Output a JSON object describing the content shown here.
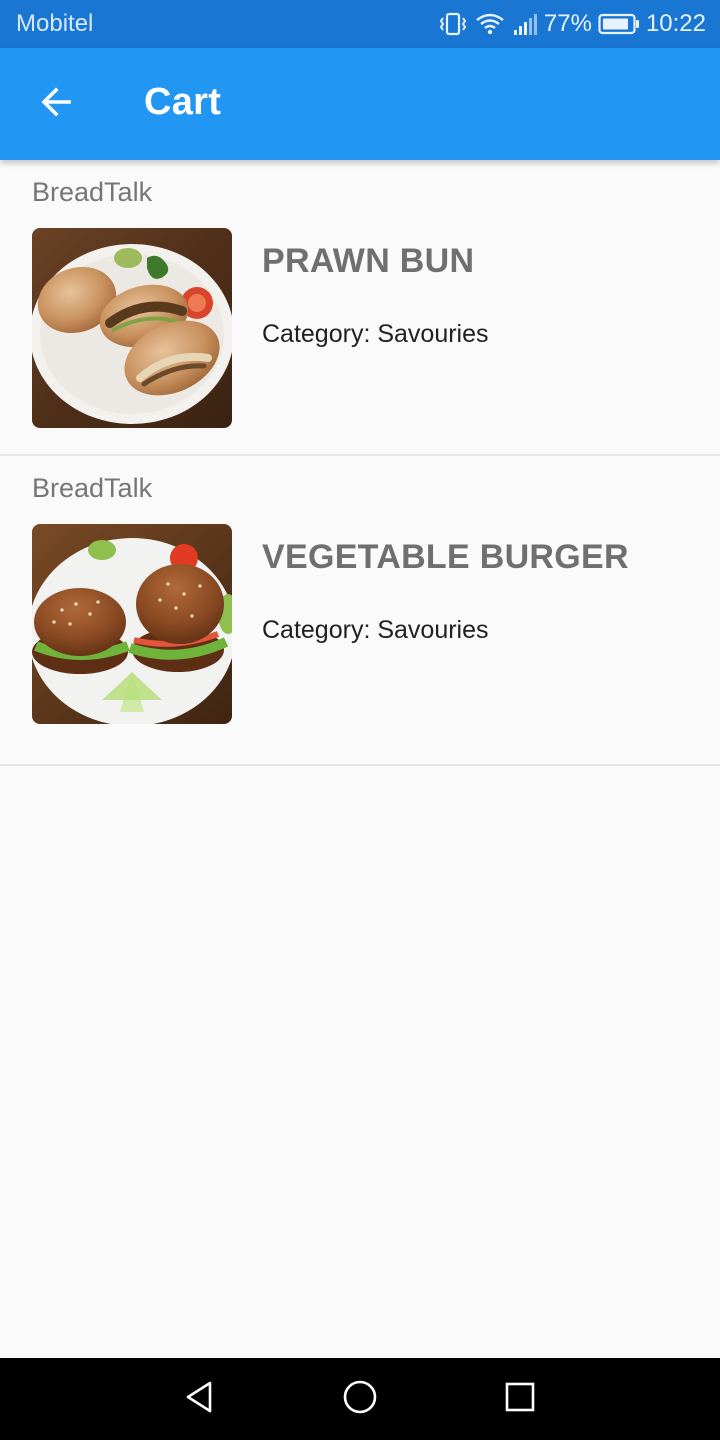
{
  "status_bar": {
    "carrier": "Mobitel",
    "battery": "77%",
    "time": "10:22"
  },
  "app_bar": {
    "title": "Cart",
    "back_icon": "arrow-back-icon"
  },
  "cart_items": [
    {
      "store": "BreadTalk",
      "name": "PRAWN BUN",
      "category": "Category: Savouries",
      "image": "prawn-bun-photo"
    },
    {
      "store": "BreadTalk",
      "name": "VEGETABLE BURGER",
      "category": "Category: Savouries",
      "image": "vegetable-burger-photo"
    }
  ],
  "nav_bar": {
    "back_icon": "triangle-back-icon",
    "home_icon": "circle-home-icon",
    "recents_icon": "square-recents-icon"
  },
  "colors": {
    "status_bar": "#1976d2",
    "app_bar": "#2196f3",
    "background": "#fafafa",
    "nav_bar": "#000000"
  }
}
